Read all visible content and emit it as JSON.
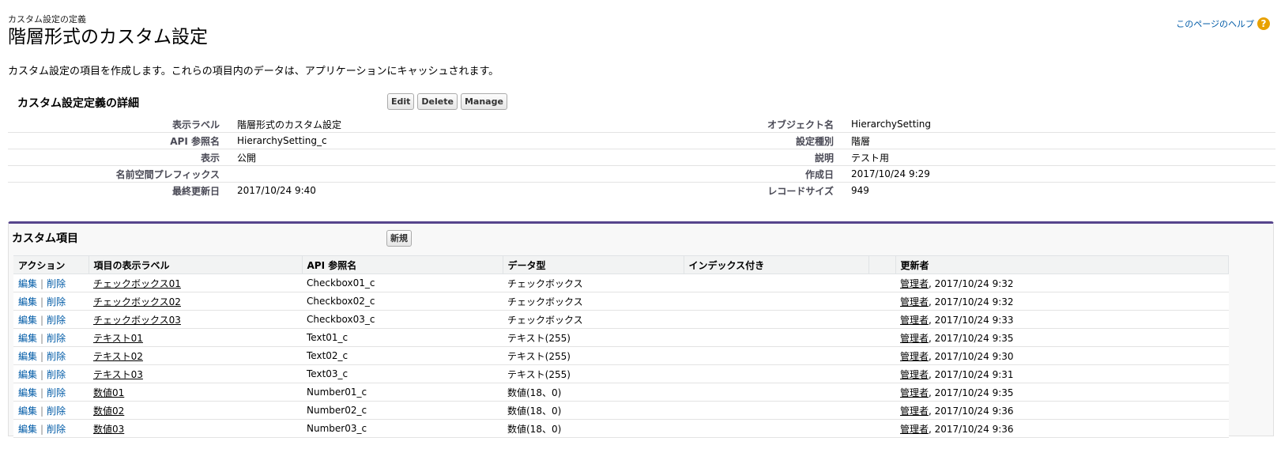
{
  "header": {
    "breadcrumb": "カスタム設定の定義",
    "title": "階層形式のカスタム設定",
    "help_link": "このページのヘルプ",
    "help_icon": "?"
  },
  "intro": "カスタム設定の項目を作成します。これらの項目内のデータは、アプリケーションにキャッシュされます。",
  "detail": {
    "title": "カスタム設定定義の詳細",
    "buttons": {
      "edit": "Edit",
      "delete": "Delete",
      "manage": "Manage"
    },
    "rows": [
      {
        "l1": "表示ラベル",
        "v1": "階層形式のカスタム設定",
        "l2": "オブジェクト名",
        "v2": "HierarchySetting"
      },
      {
        "l1": "API 参照名",
        "v1": "HierarchySetting_c",
        "l2": "設定種別",
        "v2": "階層"
      },
      {
        "l1": "表示",
        "v1": "公開",
        "l2": "説明",
        "v2": "テスト用"
      },
      {
        "l1": "名前空間プレフィックス",
        "v1": "",
        "l2": "作成日",
        "v2": "2017/10/24 9:29"
      },
      {
        "l1": "最終更新日",
        "v1": "2017/10/24 9:40",
        "l2": "レコードサイズ",
        "v2": "949"
      }
    ]
  },
  "fields": {
    "title": "カスタム項目",
    "new_button": "新規",
    "columns": [
      "アクション",
      "項目の表示ラベル",
      "API 参照名",
      "データ型",
      "インデックス付き",
      "",
      "更新者"
    ],
    "action_edit": "編集",
    "action_sep": "|",
    "action_delete": "削除",
    "rows": [
      {
        "label": "チェックボックス01",
        "api": "Checkbox01_c",
        "type": "チェックボックス",
        "indexed": "",
        "user": "管理者",
        "date": ", 2017/10/24 9:32"
      },
      {
        "label": "チェックボックス02",
        "api": "Checkbox02_c",
        "type": "チェックボックス",
        "indexed": "",
        "user": "管理者",
        "date": ", 2017/10/24 9:32"
      },
      {
        "label": "チェックボックス03",
        "api": "Checkbox03_c",
        "type": "チェックボックス",
        "indexed": "",
        "user": "管理者",
        "date": ", 2017/10/24 9:33"
      },
      {
        "label": "テキスト01",
        "api": "Text01_c",
        "type": "テキスト(255)",
        "indexed": "",
        "user": "管理者",
        "date": ", 2017/10/24 9:35"
      },
      {
        "label": "テキスト02",
        "api": "Text02_c",
        "type": "テキスト(255)",
        "indexed": "",
        "user": "管理者",
        "date": ", 2017/10/24 9:30"
      },
      {
        "label": "テキスト03",
        "api": "Text03_c",
        "type": "テキスト(255)",
        "indexed": "",
        "user": "管理者",
        "date": ", 2017/10/24 9:31"
      },
      {
        "label": "数値01",
        "api": "Number01_c",
        "type": "数値(18、0)",
        "indexed": "",
        "user": "管理者",
        "date": ", 2017/10/24 9:35"
      },
      {
        "label": "数値02",
        "api": "Number02_c",
        "type": "数値(18、0)",
        "indexed": "",
        "user": "管理者",
        "date": ", 2017/10/24 9:36"
      },
      {
        "label": "数値03",
        "api": "Number03_c",
        "type": "数値(18、0)",
        "indexed": "",
        "user": "管理者",
        "date": ", 2017/10/24 9:36"
      }
    ]
  }
}
